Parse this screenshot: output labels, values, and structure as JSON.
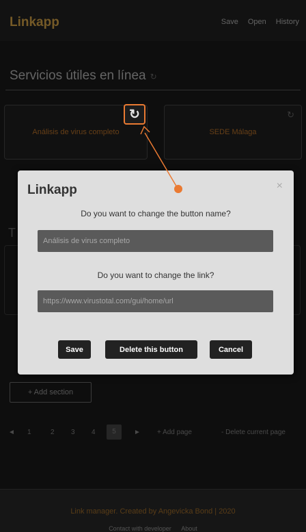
{
  "header": {
    "brand": "Linkapp",
    "nav": [
      "Save",
      "Open",
      "History"
    ]
  },
  "section": {
    "title": "Servicios útiles en línea",
    "refresh_icon": "refresh-icon"
  },
  "buttons": [
    {
      "label": "Análisis de virus completo"
    },
    {
      "label": "SEDE Málaga"
    }
  ],
  "behind": {
    "letter": "T"
  },
  "modal": {
    "title": "Linkapp",
    "close_icon": "×",
    "question_name": "Do you want to change the button name?",
    "name_value": "Análisis de virus completo",
    "question_link": "Do you want to change the link?",
    "link_value": "https://www.virustotal.com/gui/home/url",
    "save_label": "Save",
    "delete_label": "Delete this button",
    "cancel_label": "Cancel"
  },
  "add_section": "+ Add section",
  "pagination": {
    "prev": "◄",
    "pages": [
      "1",
      "2",
      "3",
      "4"
    ],
    "current": "5",
    "next": "►",
    "add_page": "+ Add page",
    "delete_page": "- Delete current page"
  },
  "footer": {
    "credit": "Link manager. Created by Angevicka Bond | 2020",
    "links": [
      "Contact with developer",
      "About"
    ]
  },
  "colors": {
    "highlight": "#ea7a32",
    "accent": "#8a6a2e"
  }
}
